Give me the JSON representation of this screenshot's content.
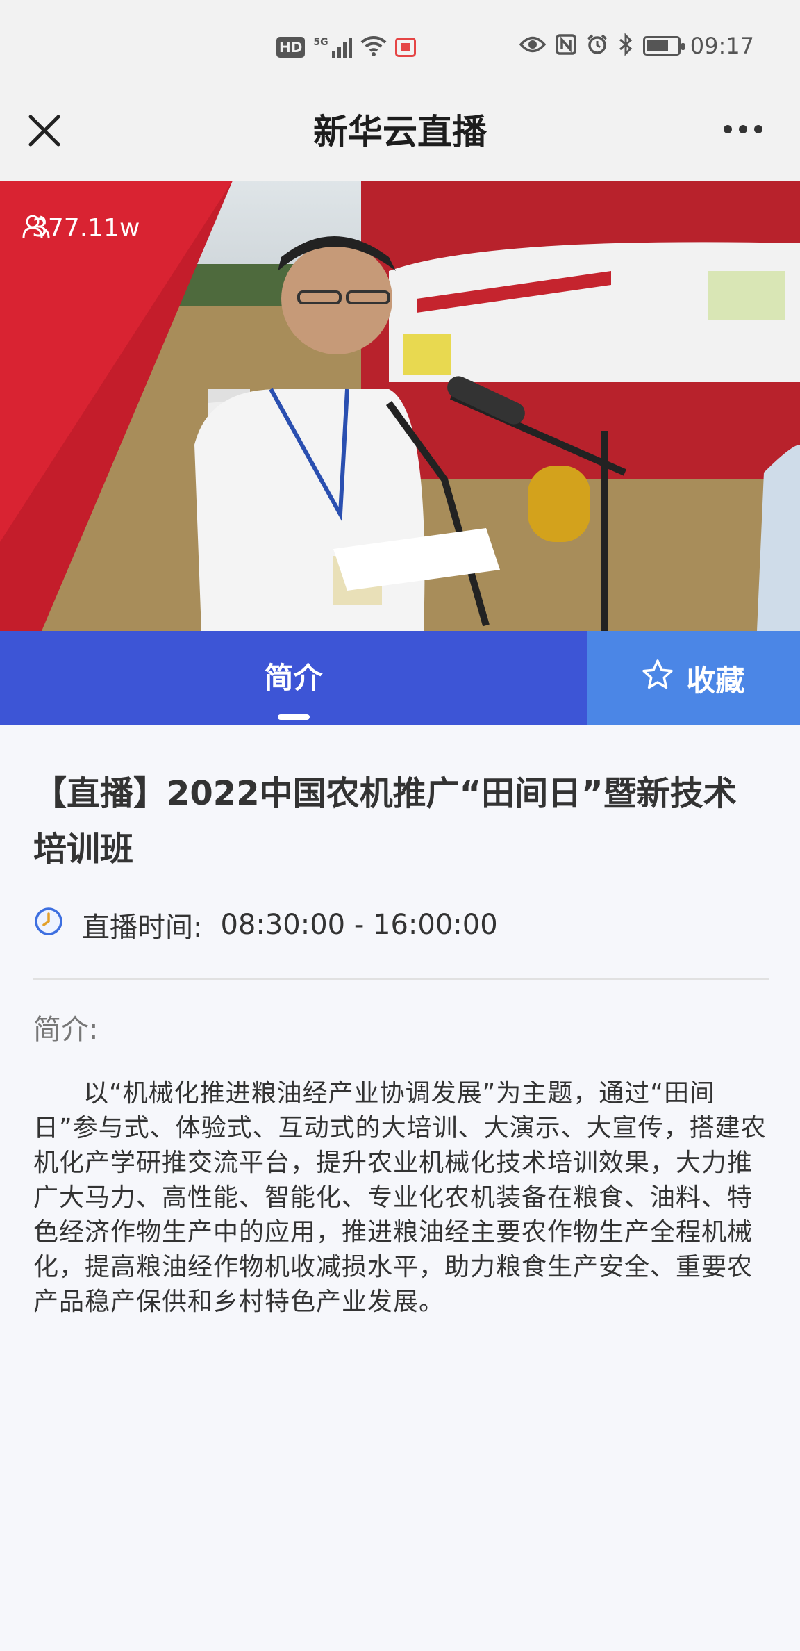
{
  "status_bar": {
    "left_icons": [
      "hd-badge",
      "5g-signal-icon",
      "wifi-icon",
      "app-notification-icon"
    ],
    "hd_label": "HD",
    "right_icons": [
      "eye-icon",
      "nfc-icon",
      "alarm-icon",
      "bluetooth-icon",
      "battery-icon"
    ],
    "time": "09:17"
  },
  "navbar": {
    "title": "新华云直播",
    "close_icon": "close-icon",
    "more_icon": "more-icon"
  },
  "video": {
    "viewer_count": "377.11w",
    "viewer_icon": "people-icon"
  },
  "tabs": {
    "intro_label": "简介",
    "favorite_label": "收藏",
    "favorite_icon": "star-outline-icon",
    "active": "简介",
    "colors": {
      "intro_bg": "#3d55d6",
      "favorite_bg": "#4b86e6"
    }
  },
  "content": {
    "title": "【直播】2022中国农机推广“田间日”暨新技术培训班",
    "time_label": "直播时间:",
    "time_value": "08:30:00 - 16:00:00",
    "clock_icon": "clock-icon",
    "intro_heading": "简介:",
    "intro_body": "以“机械化推进粮油经产业协调发展”为主题，通过“田间日”参与式、体验式、互动式的大培训、大演示、大宣传，搭建农机化产学研推交流平台，提升农业机械化技术培训效果，大力推广大马力、高性能、智能化、专业化农机装备在粮食、油料、特色经济作物生产中的应用，推进粮油经主要农作物生产全程机械化，提高粮油经作物机收减损水平，助力粮食生产安全、重要农产品稳产保供和乡村特色产业发展。"
  }
}
